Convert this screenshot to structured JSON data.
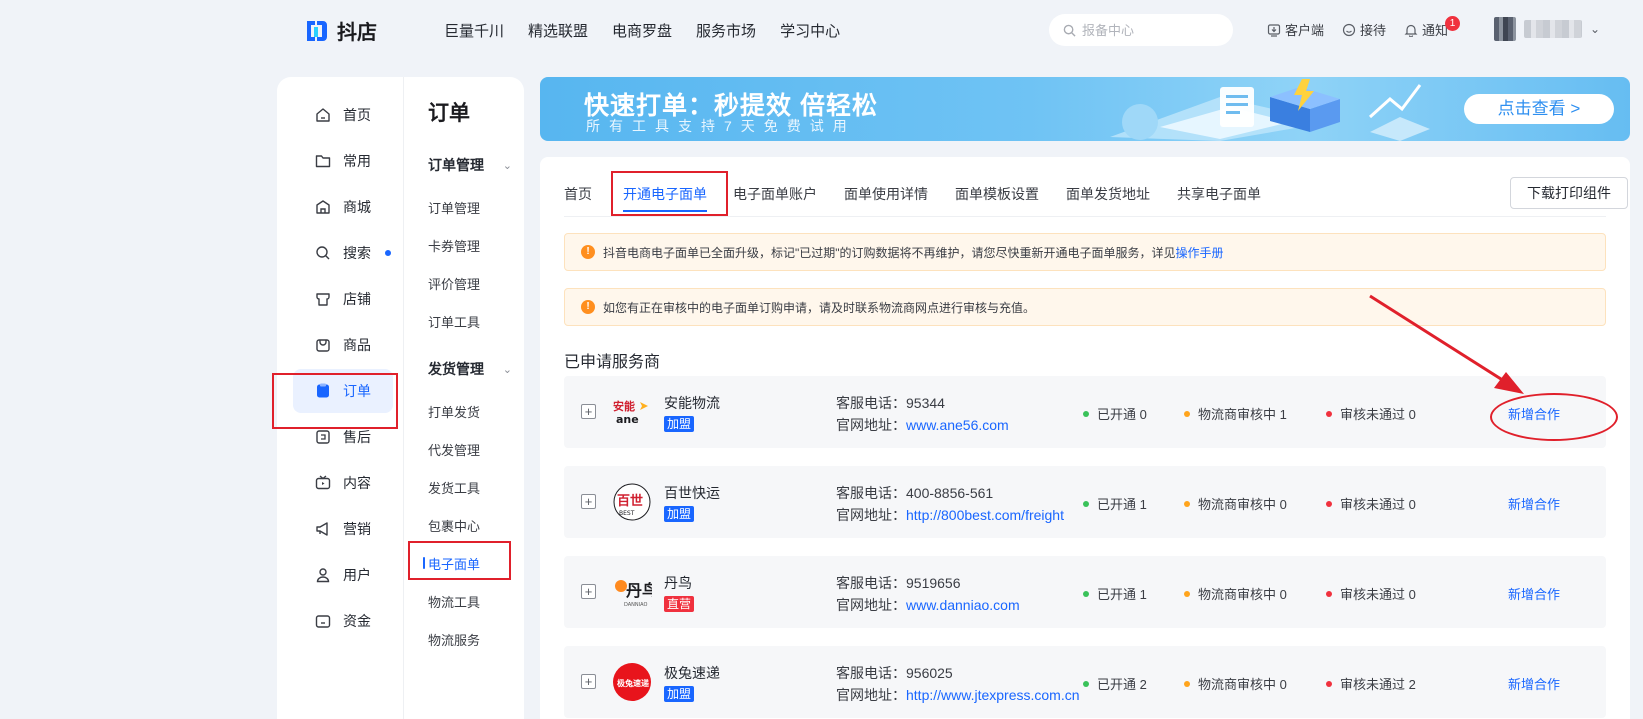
{
  "brand": {
    "name": "抖店"
  },
  "topnav": [
    "巨量千川",
    "精选联盟",
    "电商罗盘",
    "服务市场",
    "学习中心"
  ],
  "search": {
    "placeholder": "报备中心"
  },
  "top_actions": {
    "client": "客户端",
    "reception": "接待",
    "notice": "通知",
    "notice_count": "1"
  },
  "sidebar": {
    "primary": [
      {
        "label": "首页",
        "icon": "home-icon"
      },
      {
        "label": "常用",
        "icon": "folder-icon"
      },
      {
        "label": "商城",
        "icon": "mall-icon"
      },
      {
        "label": "搜索",
        "icon": "search-icon",
        "dot": true
      },
      {
        "label": "店铺",
        "icon": "store-icon"
      },
      {
        "label": "商品",
        "icon": "goods-icon"
      },
      {
        "label": "订单",
        "icon": "order-icon",
        "active": true
      },
      {
        "label": "售后",
        "icon": "aftersale-icon"
      },
      {
        "label": "内容",
        "icon": "tv-icon"
      },
      {
        "label": "营销",
        "icon": "megaphone-icon"
      },
      {
        "label": "用户",
        "icon": "user-icon"
      },
      {
        "label": "资金",
        "icon": "wallet-icon"
      }
    ],
    "secondary_title": "订单",
    "groups": [
      {
        "title": "订单管理",
        "items": [
          "订单管理",
          "卡券管理",
          "评价管理",
          "订单工具"
        ]
      },
      {
        "title": "发货管理",
        "items": [
          "打单发货",
          "代发管理",
          "发货工具",
          "包裹中心",
          "电子面单",
          "物流工具",
          "物流服务"
        ]
      }
    ],
    "active_secondary": "电子面单"
  },
  "banner": {
    "title": "快速打单：秒提效 倍轻松",
    "subtitle": "所有工具支持7天免费试用",
    "button": "点击查看 >"
  },
  "tabs": [
    "首页",
    "开通电子面单",
    "电子面单账户",
    "面单使用详情",
    "面单模板设置",
    "面单发货地址",
    "共享电子面单"
  ],
  "active_tab": "开通电子面单",
  "download_button": "下载打印组件",
  "notices": [
    {
      "text": "抖音电商电子面单已全面升级，标记\"已过期\"的订购数据将不再维护，请您尽快重新开通电子面单服务，详见",
      "link": "操作手册"
    },
    {
      "text": "如您有正在审核中的电子面单订购申请，请及时联系物流商网点进行审核与充值。",
      "link": ""
    }
  ],
  "section_title": "已申请服务商",
  "labels": {
    "phone": "客服电话：",
    "site": "官网地址：",
    "opened": "已开通",
    "reviewing": "物流商审核中",
    "rejected": "审核未通过",
    "add": "新增合作"
  },
  "status_colors": {
    "opened": "#3ac25a",
    "reviewing": "#ffa41c",
    "rejected": "#f0313e"
  },
  "carriers": [
    {
      "name": "安能物流",
      "tag": "加盟",
      "tag_type": "join",
      "phone": "95344",
      "site": "www.ane56.com",
      "opened": "0",
      "reviewing": "1",
      "rejected": "0",
      "logo": "ane-logo"
    },
    {
      "name": "百世快运",
      "tag": "加盟",
      "tag_type": "join",
      "phone": "400-8856-561",
      "site": "http://800best.com/freight",
      "opened": "1",
      "reviewing": "0",
      "rejected": "0",
      "logo": "best-logo"
    },
    {
      "name": "丹鸟",
      "tag": "直营",
      "tag_type": "direct",
      "phone": "9519656",
      "site": "www.danniao.com",
      "opened": "1",
      "reviewing": "0",
      "rejected": "0",
      "logo": "danniao-logo"
    },
    {
      "name": "极兔速递",
      "tag": "加盟",
      "tag_type": "join",
      "phone": "956025",
      "site": "http://www.jtexpress.com.cn",
      "opened": "2",
      "reviewing": "0",
      "rejected": "2",
      "logo": "jtexpress-logo"
    }
  ]
}
